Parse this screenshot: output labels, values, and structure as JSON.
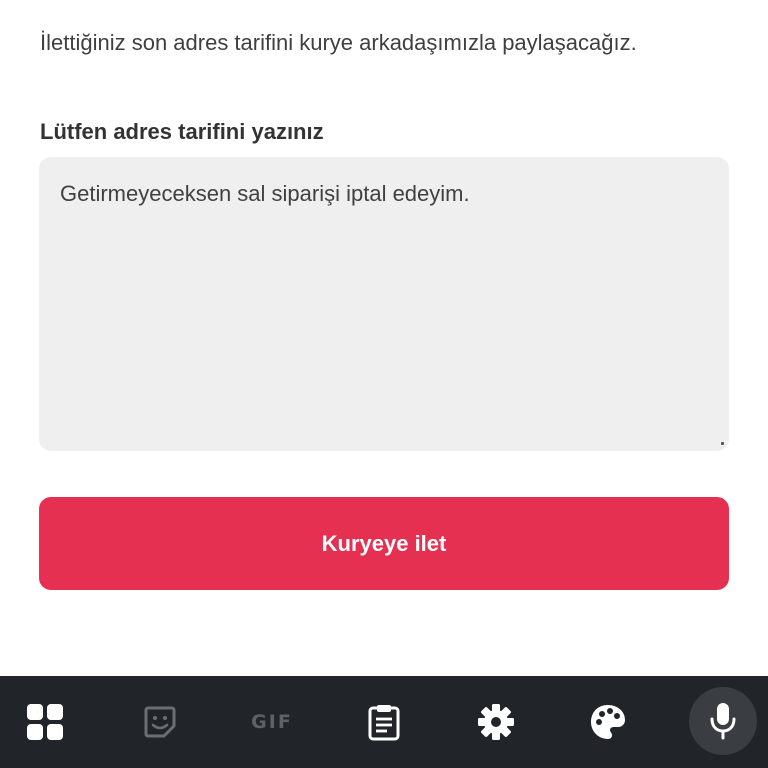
{
  "info_text": "İlettiğiniz son adres tarifini kurye arkadaşımızla paylaşacağız.",
  "address_field": {
    "label": "Lütfen adres tarifini yazınız",
    "value": "Getirmeyeceksen sal siparişi iptal edeyim."
  },
  "submit_button": {
    "label": "Kuryeye ilet"
  },
  "keyboard_toolbar": {
    "items": [
      {
        "name": "apps-grid-icon"
      },
      {
        "name": "sticker-icon"
      },
      {
        "name": "gif-button",
        "label": "GIF"
      },
      {
        "name": "clipboard-icon"
      },
      {
        "name": "settings-gear-icon"
      },
      {
        "name": "palette-icon"
      },
      {
        "name": "microphone-icon"
      }
    ]
  },
  "colors": {
    "accent": "#e53052",
    "field_background": "#efefef",
    "keyboard_bar": "#212529"
  }
}
